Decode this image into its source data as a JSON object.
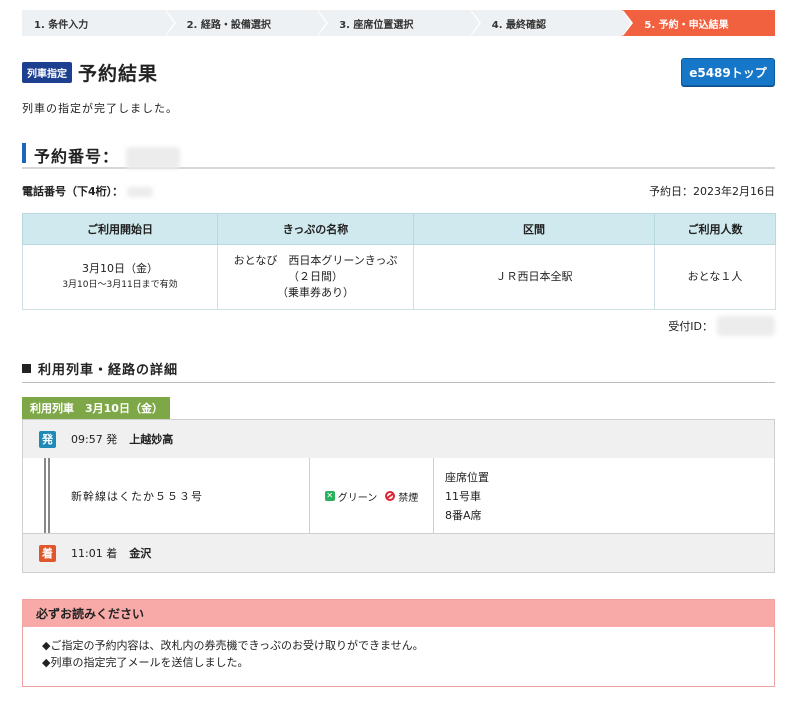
{
  "steps": [
    "1. 条件入力",
    "2. 経路・設備選択",
    "3. 座席位置選択",
    "4. 最終確認",
    "5. 予約・申込結果"
  ],
  "header": {
    "badge": "列車指定",
    "title": "予約結果",
    "top_button": "e5489トップ"
  },
  "message": "列車の指定が完了しました。",
  "reservation": {
    "number_label": "予約番号："
  },
  "phone": {
    "label": "電話番号（下4桁）：",
    "reserve_date": "予約日：2023年2月16日"
  },
  "ticket_table": {
    "headers": [
      "ご利用開始日",
      "きっぷの名称",
      "区間",
      "ご利用人数"
    ],
    "row": {
      "start_date": "3月10日（金）",
      "valid": "3月10日〜3月11日まで有効",
      "name_line1": "おとなび　西日本グリーンきっぷ",
      "name_line2": "（２日間）",
      "name_line3": "（乗車券あり）",
      "section": "ＪＲ西日本全駅",
      "people": "おとな１人"
    }
  },
  "uketsuke": {
    "label": "受付ID："
  },
  "route_section": {
    "title": "利用列車・経路の詳細",
    "tab": "利用列車　3月10日（金）"
  },
  "departure": {
    "badge": "発",
    "time": "09:57 発",
    "station": "上越妙高"
  },
  "train": {
    "name": "新幹線はくたか５５３号",
    "car_class": "グリーン",
    "smoking": "禁煙",
    "seat_title": "座席位置",
    "car": "11号車",
    "seat": "8番A席"
  },
  "arrival": {
    "badge": "着",
    "time": "11:01 着",
    "station": "金沢"
  },
  "notice": {
    "title": "必ずお読みください",
    "lines": [
      "◆ご指定の予約内容は、改札内の券売機できっぷのお受け取りができません。",
      "◆列車の指定完了メールを送信しました。"
    ]
  }
}
